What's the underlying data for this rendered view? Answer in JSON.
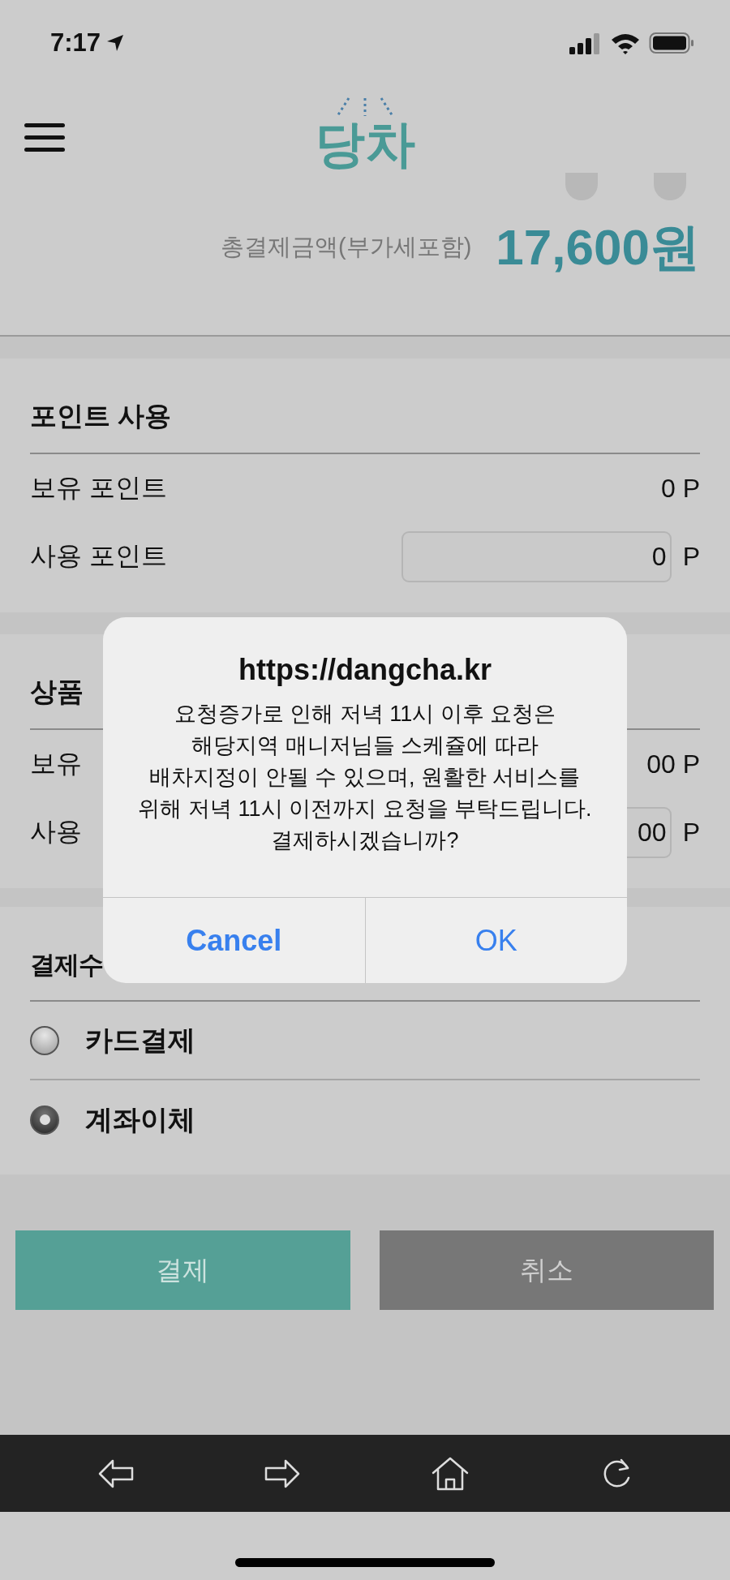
{
  "status_bar": {
    "time": "7:17"
  },
  "header": {
    "logo": "당차"
  },
  "summary": {
    "label": "총결제금액(부가세포함)",
    "amount": "17,600원"
  },
  "points": {
    "title": "포인트 사용",
    "rows": [
      {
        "kind": "value",
        "label": "보유 포인트",
        "value": "0 P"
      },
      {
        "kind": "input",
        "label": "사용 포인트",
        "value": "0",
        "unit": "P"
      }
    ]
  },
  "voucher": {
    "title": "상품",
    "rows": [
      {
        "kind": "value",
        "label": "보유",
        "value": "00 P"
      },
      {
        "kind": "input",
        "label": "사용",
        "value": "00",
        "unit": "P"
      }
    ]
  },
  "payment_method": {
    "title": "결제수",
    "options": [
      {
        "label": "카드결제",
        "selected": false
      },
      {
        "label": "계좌이체",
        "selected": true
      }
    ]
  },
  "buttons": [
    {
      "kind": "primary",
      "label": "결제"
    },
    {
      "kind": "secondary",
      "label": "취소"
    }
  ],
  "dialog": {
    "title": "https://dangcha.kr",
    "message": "요청증가로 인해 저녁 11시 이후 요청은\n해당지역 매니저님들 스케쥴에 따라\n배차지정이 안될 수 있으며, 원활한 서비스를\n위해 저녁 11시 이전까지 요청을 부탁드립니다.\n결제하시겠습니까?",
    "buttons": [
      {
        "kind": "cancel",
        "label": "Cancel"
      },
      {
        "kind": "default",
        "label": "OK"
      }
    ]
  }
}
